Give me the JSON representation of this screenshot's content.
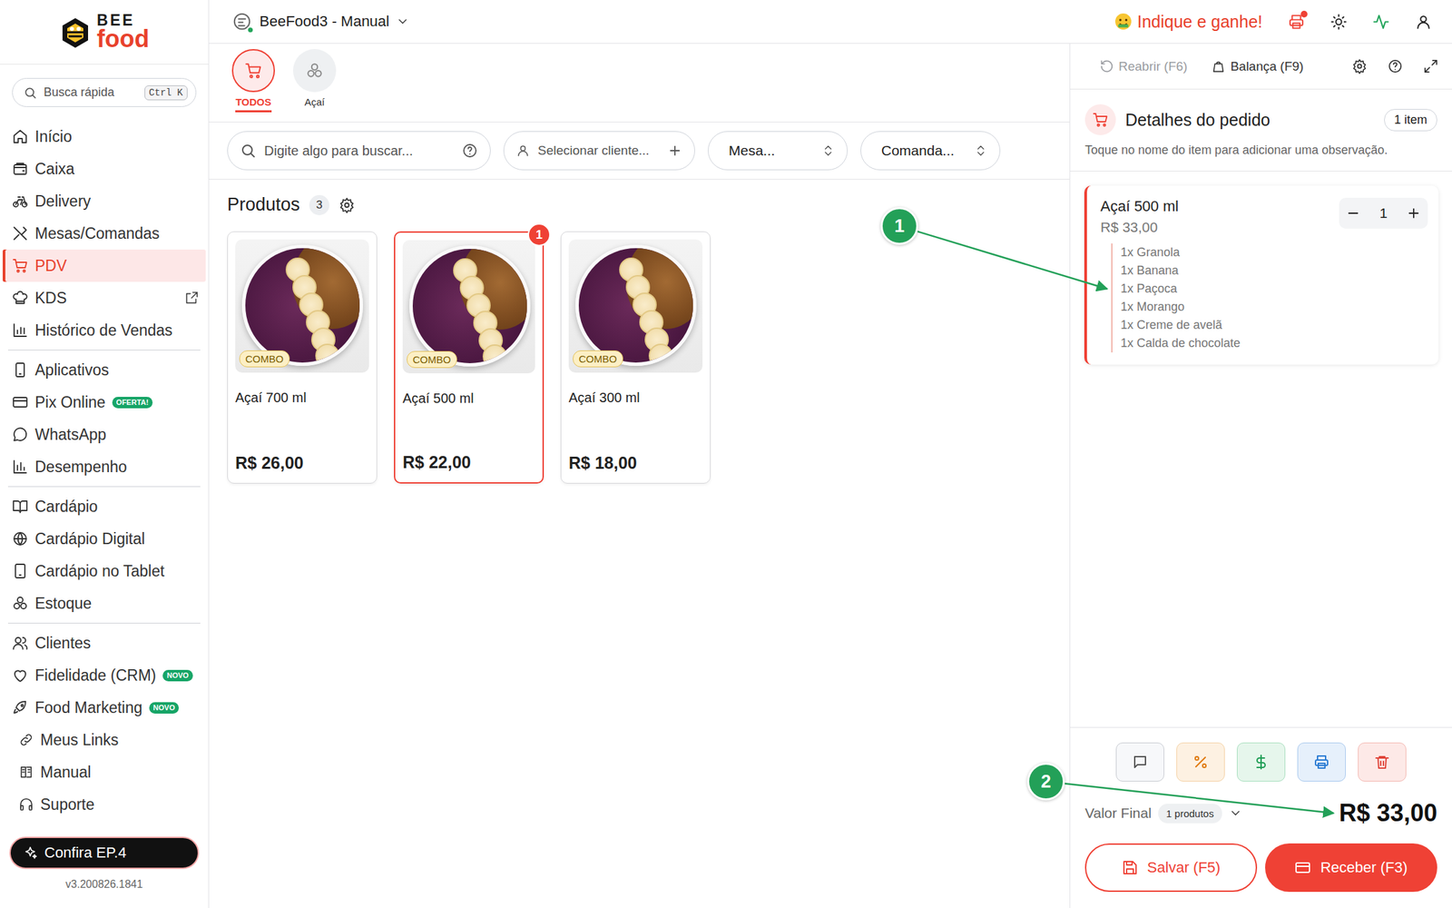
{
  "brand": {
    "line1": "BEE",
    "line2": "food"
  },
  "quick_search": {
    "placeholder": "Busca rápida",
    "shortcut": "Ctrl K"
  },
  "sidebar": {
    "groups": [
      {
        "items": [
          {
            "label": "Início",
            "selected": false,
            "external": false
          },
          {
            "label": "Caixa",
            "selected": false,
            "external": false
          },
          {
            "label": "Delivery",
            "selected": false,
            "external": false
          },
          {
            "label": "Mesas/Comandas",
            "selected": false,
            "external": false
          },
          {
            "label": "PDV",
            "selected": true,
            "external": false
          },
          {
            "label": "KDS",
            "selected": false,
            "external": true
          },
          {
            "label": "Histórico de Vendas",
            "selected": false,
            "external": false
          }
        ]
      },
      {
        "items": [
          {
            "label": "Aplicativos",
            "selected": false,
            "external": false
          },
          {
            "label": "Pix Online",
            "selected": false,
            "external": false,
            "badge": "OFERTA!"
          },
          {
            "label": "WhatsApp",
            "selected": false,
            "external": false
          },
          {
            "label": "Desempenho",
            "selected": false,
            "external": false
          }
        ]
      },
      {
        "items": [
          {
            "label": "Cardápio",
            "selected": false,
            "external": false
          },
          {
            "label": "Cardápio Digital",
            "selected": false,
            "external": false
          },
          {
            "label": "Cardápio no Tablet",
            "selected": false,
            "external": false
          },
          {
            "label": "Estoque",
            "selected": false,
            "external": false
          }
        ]
      },
      {
        "items": [
          {
            "label": "Clientes",
            "selected": false,
            "external": false
          },
          {
            "label": "Fidelidade (CRM)",
            "selected": false,
            "external": false,
            "badge": "NOVO"
          },
          {
            "label": "Food Marketing",
            "selected": false,
            "external": false,
            "badge": "NOVO"
          }
        ]
      }
    ],
    "links": [
      {
        "label": "Meus Links",
        "selected": false
      },
      {
        "label": "Manual",
        "selected": false
      },
      {
        "label": "Suporte",
        "selected": false
      }
    ],
    "promo": "Confira EP.4",
    "version": "v3.200826.1841"
  },
  "topbar": {
    "store": "BeeFood3 - Manual",
    "store_online": true,
    "referral": "Indique e ganhe!",
    "printer_alert": true
  },
  "categories": [
    {
      "label": "TODOS",
      "selected": true
    },
    {
      "label": "Açaí",
      "selected": false
    }
  ],
  "filters": {
    "search": "Digite algo para buscar...",
    "client": "Selecionar cliente...",
    "table": "Mesa...",
    "tab": "Comanda..."
  },
  "products": {
    "title": "Produtos",
    "count": "3",
    "items": [
      {
        "name": "Açaí 700 ml",
        "price": "R$ 26,00",
        "tag": "COMBO",
        "selected": false
      },
      {
        "name": "Açaí 500 ml",
        "price": "R$ 22,00",
        "tag": "COMBO",
        "selected": true,
        "in_cart": "1"
      },
      {
        "name": "Açaí 300 ml",
        "price": "R$ 18,00",
        "tag": "COMBO",
        "selected": false
      }
    ]
  },
  "order": {
    "toolbar": [
      {
        "label": "Reabrir (F6)",
        "disabled": true
      },
      {
        "label": "Balança (F9)",
        "disabled": false
      }
    ],
    "title": "Detalhes do pedido",
    "count": "1 item",
    "hint": "Toque no nome do item para adicionar uma observação.",
    "items": [
      {
        "name": "Açaí 500 ml",
        "price": "R$ 33,00",
        "quantity": "1",
        "addons": [
          "1x Granola",
          "1x Banana",
          "1x Paçoca",
          "1x Morango",
          "1x Creme de avelã",
          "1x Calda de chocolate"
        ]
      }
    ],
    "total_label": "Valor Final",
    "product_count": "1 produtos",
    "total": "R$ 33,00",
    "actions": [
      {
        "label": "Salvar (F5)",
        "kind": "outline"
      },
      {
        "label": "Receber (F3)",
        "kind": "primary"
      }
    ]
  },
  "annotations": [
    {
      "label": "1"
    },
    {
      "label": "2"
    }
  ]
}
